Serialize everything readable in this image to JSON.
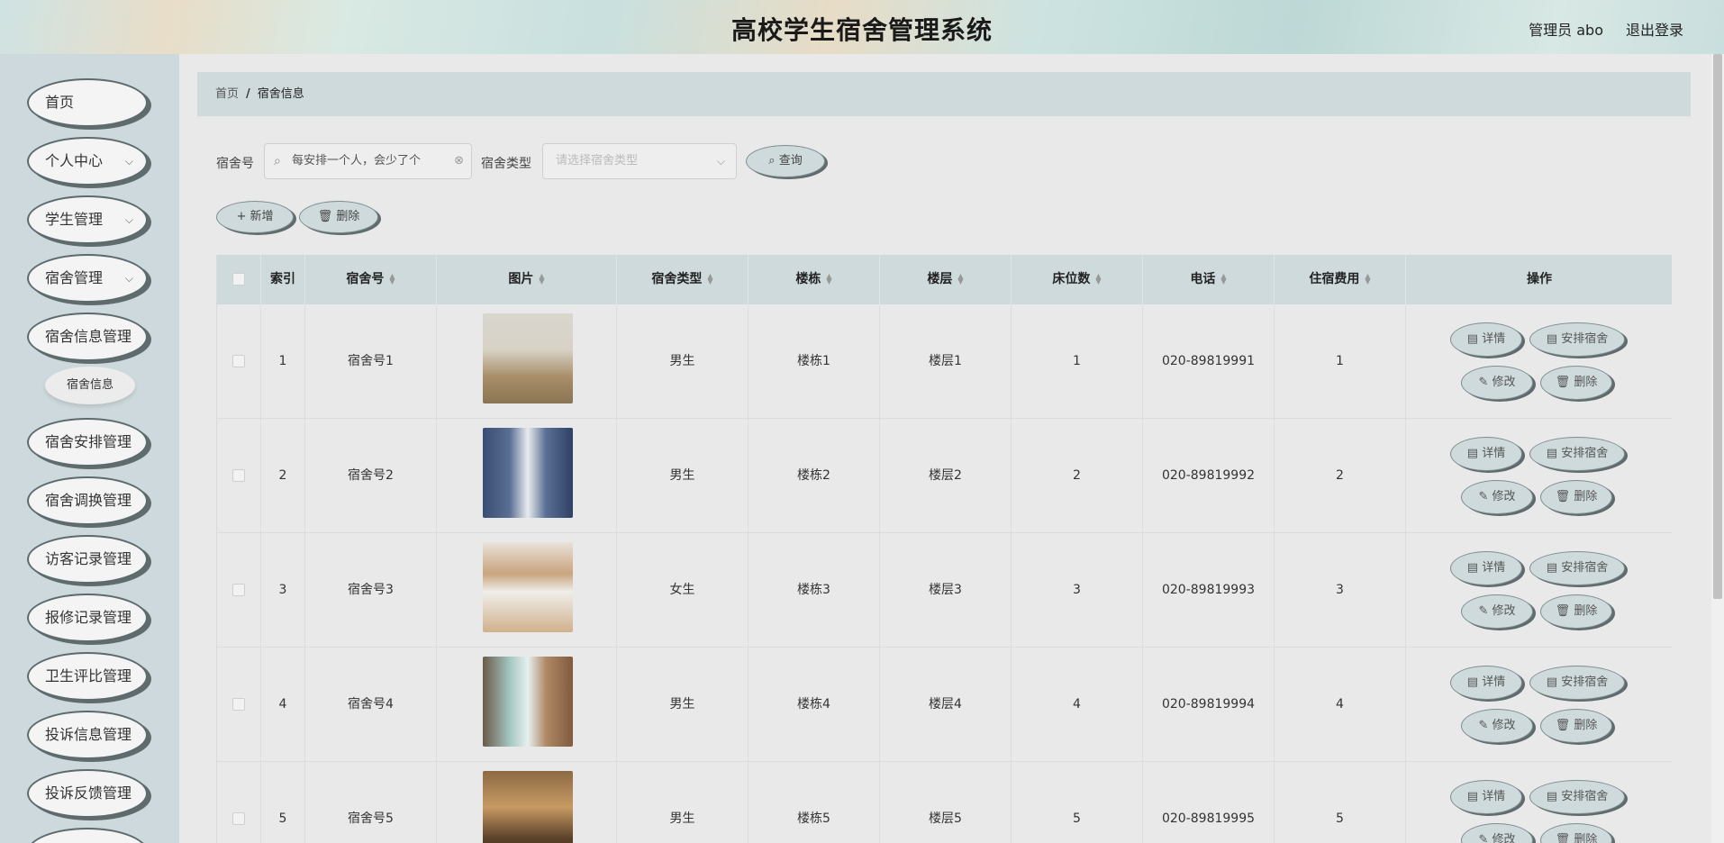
{
  "header": {
    "title": "高校学生宿舍管理系统",
    "user": "管理员 abo",
    "logout": "退出登录"
  },
  "sidebar": {
    "items": [
      {
        "label": "首页",
        "chev": ""
      },
      {
        "label": "个人中心",
        "chev": "⌵"
      },
      {
        "label": "学生管理",
        "chev": "⌵"
      },
      {
        "label": "宿舍管理",
        "chev": "⌵"
      },
      {
        "label": "宿舍信息管理",
        "chev": ""
      },
      {
        "label": "宿舍安排管理",
        "chev": ""
      },
      {
        "label": "宿舍调换管理",
        "chev": ""
      },
      {
        "label": "访客记录管理",
        "chev": ""
      },
      {
        "label": "报修记录管理",
        "chev": ""
      },
      {
        "label": "卫生评比管理",
        "chev": ""
      },
      {
        "label": "投诉信息管理",
        "chev": ""
      },
      {
        "label": "投诉反馈管理",
        "chev": ""
      }
    ],
    "sub_item": "宿舍信息"
  },
  "breadcrumb": {
    "home": "首页",
    "sep": "/",
    "current": "宿舍信息"
  },
  "search": {
    "room_label": "宿舍号",
    "room_value": "每安排一个人，会少了个",
    "type_label": "宿舍类型",
    "type_placeholder": "请选择宿舍类型",
    "query_button": "查询"
  },
  "toolbar": {
    "add": "新增",
    "delete": "删除"
  },
  "icons": {
    "search": "search-icon",
    "clear": "circle-close-icon",
    "arrow": "chevron-down-icon",
    "add": "plus-icon",
    "delete": "trash-icon",
    "detail": "document-icon",
    "edit": "edit-icon"
  },
  "table": {
    "headers": {
      "index": "索引",
      "room": "宿舍号",
      "image": "图片",
      "type": "宿舍类型",
      "building": "楼栋",
      "floor": "楼层",
      "beds": "床位数",
      "phone": "电话",
      "fee": "住宿费用",
      "ops": "操作"
    },
    "actions": {
      "detail": "详情",
      "arrange": "安排宿舍",
      "edit": "修改",
      "delete": "删除"
    },
    "rows": [
      {
        "index": "1",
        "room": "宿舍号1",
        "type": "男生",
        "building": "楼栋1",
        "floor": "楼层1",
        "beds": "1",
        "phone": "020-89819991",
        "fee": "1"
      },
      {
        "index": "2",
        "room": "宿舍号2",
        "type": "男生",
        "building": "楼栋2",
        "floor": "楼层2",
        "beds": "2",
        "phone": "020-89819992",
        "fee": "2"
      },
      {
        "index": "3",
        "room": "宿舍号3",
        "type": "女生",
        "building": "楼栋3",
        "floor": "楼层3",
        "beds": "3",
        "phone": "020-89819993",
        "fee": "3"
      },
      {
        "index": "4",
        "room": "宿舍号4",
        "type": "男生",
        "building": "楼栋4",
        "floor": "楼层4",
        "beds": "4",
        "phone": "020-89819994",
        "fee": "4"
      },
      {
        "index": "5",
        "room": "宿舍号5",
        "type": "男生",
        "building": "楼栋5",
        "floor": "楼层5",
        "beds": "5",
        "phone": "020-89819995",
        "fee": "5"
      }
    ]
  },
  "colors": {
    "accent": "#cfdadd",
    "sidebar_bg": "#cdd9dd",
    "pill_shadow": "#5f6b6c"
  }
}
